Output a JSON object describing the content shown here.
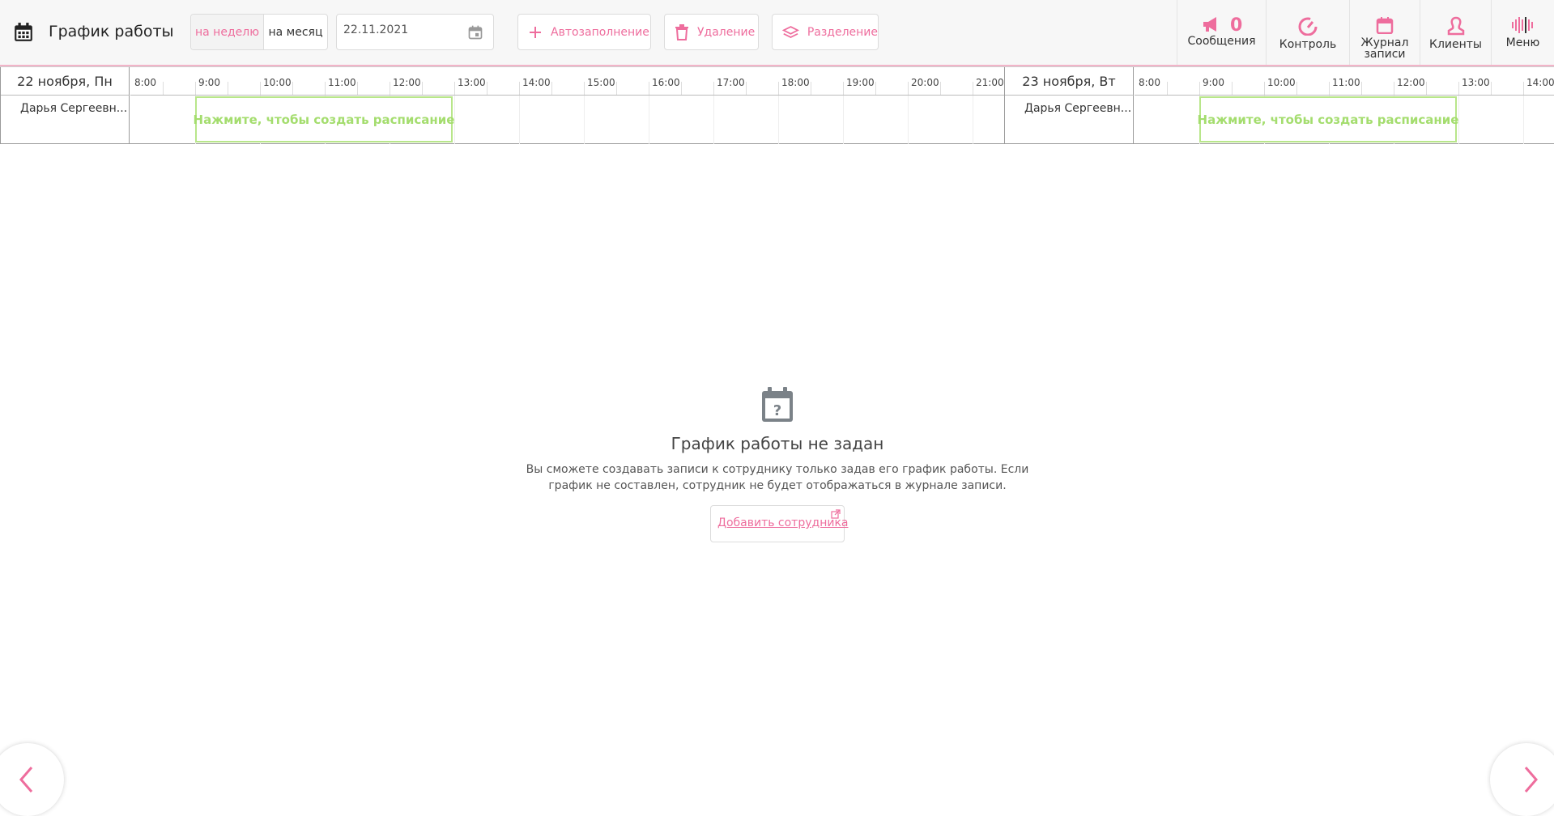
{
  "header": {
    "title": "График работы",
    "view_week": "на неделю",
    "view_month": "на месяц",
    "date_value": "22.11.2021",
    "btn_autofill": "Автозаполнение",
    "btn_delete": "Удаление",
    "btn_split": "Разделение"
  },
  "nav": {
    "messages_label": "Сообщения",
    "messages_count": "0",
    "control_label": "Контроль",
    "journal_label_1": "Журнал",
    "journal_label_2": "записи",
    "clients_label": "Клиенты",
    "menu_label": "Меню"
  },
  "days": [
    {
      "title": "22 ноября, Пн",
      "staff": "Дарья Сергеевн...",
      "hours": [
        "8:00",
        "9:00",
        "10:00",
        "11:00",
        "12:00",
        "13:00",
        "14:00",
        "15:00",
        "16:00",
        "17:00",
        "18:00",
        "19:00",
        "20:00",
        "21:00"
      ],
      "create_label": "Нажмите, чтобы создать расписание"
    },
    {
      "title": "23 ноября, Вт",
      "staff": "Дарья Сергеевн...",
      "hours": [
        "8:00",
        "9:00",
        "10:00",
        "11:00",
        "12:00",
        "13:00",
        "14:00"
      ],
      "create_label": "Нажмите, чтобы создать расписание"
    }
  ],
  "empty_state": {
    "title": "График работы не задан",
    "text_line1": "Вы сможете создавать записи к сотруднику только задав его график работы. Если",
    "text_line2": "график не составлен, сотрудник не будет отображаться в журнале записи.",
    "add_button": "Добавить сотрудника"
  },
  "colors": {
    "accent": "#ee6d9d",
    "green": "#a4dd6e",
    "icon_gray": "#7b8288"
  }
}
